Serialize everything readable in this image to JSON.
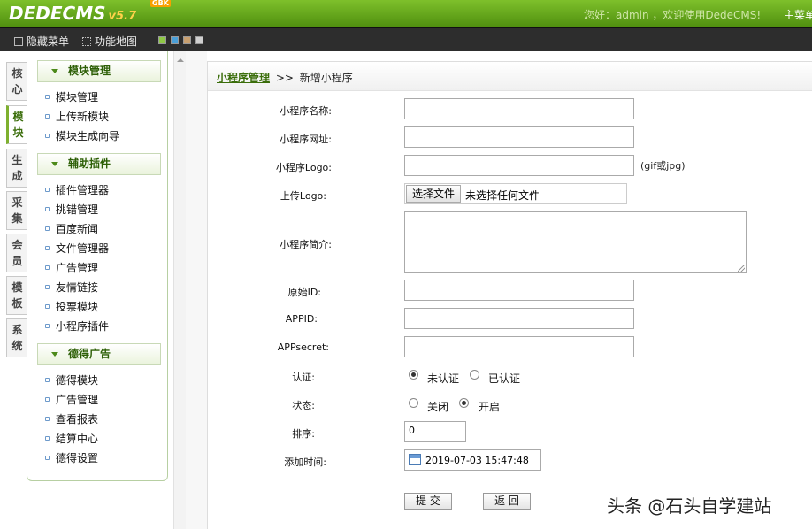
{
  "header": {
    "logo_text": "DEDECMS",
    "logo_version": "v5.7",
    "logo_badge": "GBK",
    "welcome": "您好：admin ，欢迎使用DedeCMS!",
    "main_site": "主菜单"
  },
  "menubar": {
    "hide_menu": "隐藏菜单",
    "site_map": "功能地图"
  },
  "vertical_tabs": [
    {
      "label": "核心"
    },
    {
      "label": "模块"
    },
    {
      "label": "生成"
    },
    {
      "label": "采集"
    },
    {
      "label": "会员"
    },
    {
      "label": "模板"
    },
    {
      "label": "系统"
    }
  ],
  "sidemenu": {
    "groups": [
      {
        "title": "模块管理",
        "items": [
          "模块管理",
          "上传新模块",
          "模块生成向导"
        ]
      },
      {
        "title": "辅助插件",
        "items": [
          "插件管理器",
          "挑错管理",
          "百度新闻",
          "文件管理器",
          "广告管理",
          "友情链接",
          "投票模块",
          "小程序插件"
        ]
      },
      {
        "title": "德得广告",
        "items": [
          "德得模块",
          "广告管理",
          "查看报表",
          "结算中心",
          "德得设置"
        ]
      }
    ]
  },
  "breadcrumb": {
    "link": "小程序管理",
    "sep": ">>",
    "current": "新增小程序"
  },
  "form": {
    "name_label": "小程序名称:",
    "url_label": "小程序网址:",
    "logo_label": "小程序Logo:",
    "logo_hint": "(gif或jpg)",
    "upload_label": "上传Logo:",
    "file_button": "选择文件",
    "file_status": "未选择任何文件",
    "desc_label": "小程序简介:",
    "origid_label": "原始ID:",
    "appid_label": "APPID:",
    "secret_label": "APPsecret:",
    "verify_label": "认证:",
    "verify_options": [
      "未认证",
      "已认证"
    ],
    "verify_selected": "未认证",
    "status_label": "状态:",
    "status_options": [
      "关闭",
      "开启"
    ],
    "status_selected": "开启",
    "sort_label": "排序:",
    "sort_value": "0",
    "time_label": "添加时间:",
    "time_value": "2019-07-03 15:47:48",
    "submit": "提 交",
    "back": "返 回"
  },
  "watermark": "头条 @石头自学建站",
  "colors": {
    "header_green": "#5fa31a",
    "menubar_dark": "#2d2d2d",
    "accent_green": "#3a6d0a"
  }
}
